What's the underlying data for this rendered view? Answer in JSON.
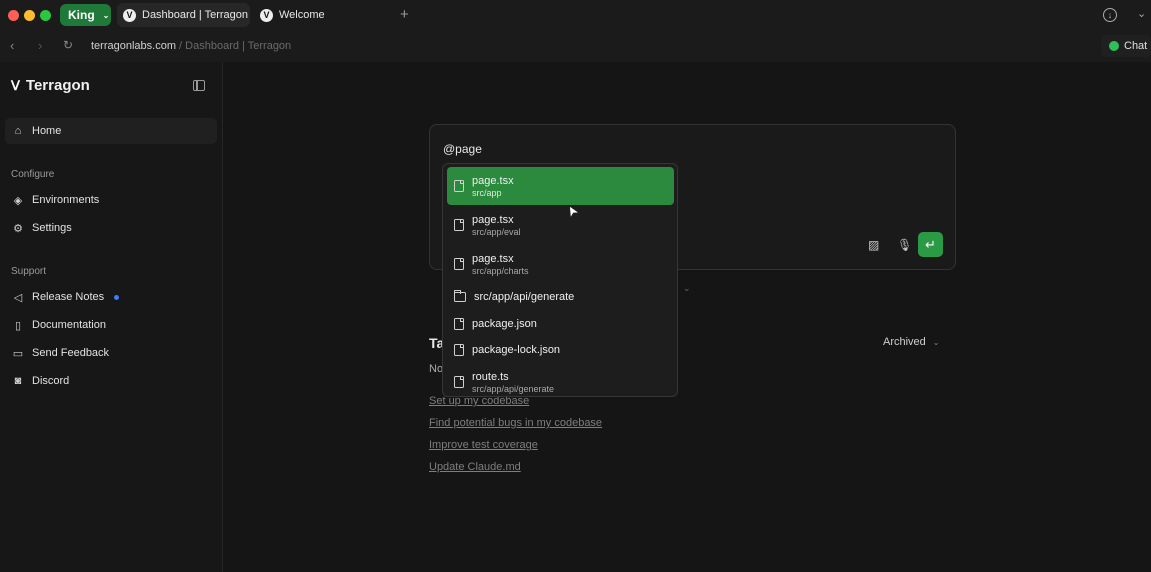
{
  "browser": {
    "profile": "King",
    "tabs": [
      {
        "title": "Dashboard | Terragon",
        "logo": "V"
      },
      {
        "title": "Welcome",
        "logo": "V"
      }
    ],
    "url_host": "terragonlabs.com",
    "url_rest": " / Dashboard | Terragon",
    "chat_label": "Chat",
    "colors": {
      "close": "#ff5f57",
      "minimize": "#febc2e",
      "maximize": "#28c840",
      "accent": "#2a9a45"
    }
  },
  "sidebar": {
    "brand": "Terragon",
    "home": "Home",
    "configure_title": "Configure",
    "environments": "Environments",
    "settings": "Settings",
    "support_title": "Support",
    "release_notes": "Release Notes",
    "documentation": "Documentation",
    "send_feedback": "Send Feedback",
    "discord": "Discord"
  },
  "composer": {
    "text": "@page"
  },
  "mention": {
    "items": [
      {
        "name": "page.tsx",
        "path": "src/app",
        "kind": "file",
        "selected": true
      },
      {
        "name": "page.tsx",
        "path": "src/app/eval",
        "kind": "file"
      },
      {
        "name": "page.tsx",
        "path": "src/app/charts",
        "kind": "file"
      },
      {
        "name": "src/app/api/generate",
        "kind": "folder"
      },
      {
        "name": "package.json",
        "kind": "file"
      },
      {
        "name": "package-lock.json",
        "kind": "file"
      },
      {
        "name": "route.ts",
        "path": "src/app/api/generate",
        "kind": "file"
      }
    ]
  },
  "tasks": {
    "heading_partial": "Ta",
    "empty_partial": "No",
    "archived": "Archived",
    "suggestions": [
      "Set up my codebase",
      "Find potential bugs in my codebase",
      "Improve test coverage",
      "Update Claude.md"
    ]
  }
}
